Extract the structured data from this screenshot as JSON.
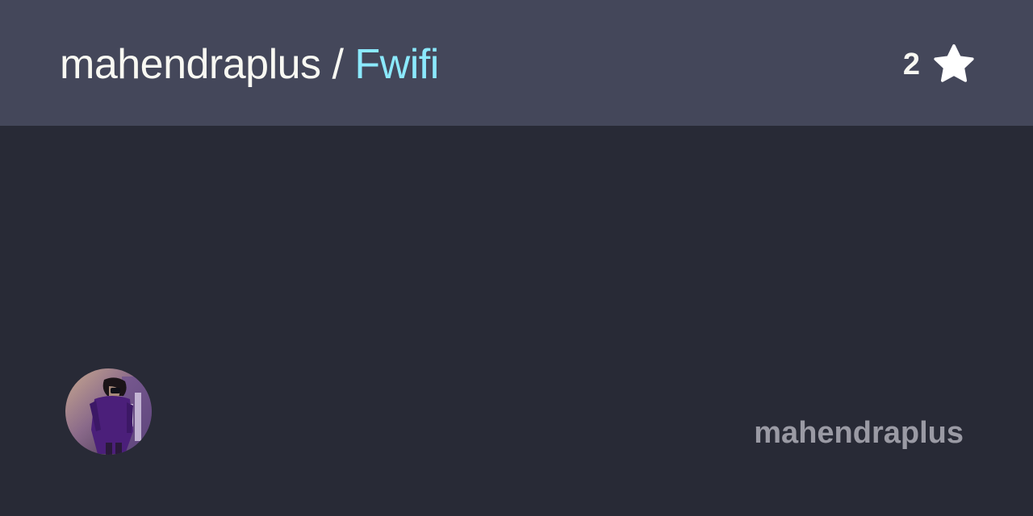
{
  "header": {
    "owner": "mahendraplus",
    "separator": " / ",
    "repo_name": "Fwifi",
    "star_count": "2",
    "star_icon": "star-icon"
  },
  "footer": {
    "username": "mahendraplus",
    "avatar_icon": "avatar-photo"
  },
  "colors": {
    "background": "#282a36",
    "header_background": "#44475a",
    "title_text": "#f8f8f2",
    "repo_name": "#8be9fd",
    "username_text": "#9a9aa4"
  }
}
